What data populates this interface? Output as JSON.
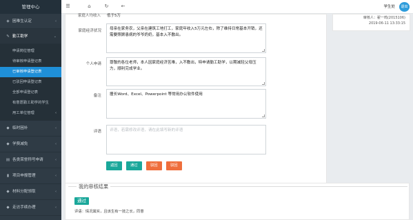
{
  "sidebar": {
    "title": "管理中心",
    "groups": [
      {
        "label": "困难生认定",
        "icon": "shield-icon",
        "chevron": "‹"
      },
      {
        "label": "勤工助学",
        "icon": "pen-icon",
        "chevron": "⌄"
      }
    ],
    "sub_items": [
      {
        "label": "申请岗位管理"
      },
      {
        "label": "待审核申请登记表"
      },
      {
        "label": "已审核申请登记表"
      },
      {
        "label": "已驳回申请登记表"
      },
      {
        "label": "全部申请登记表"
      },
      {
        "label": "有意愿勤工助学的学生"
      },
      {
        "label": "用工单位管理",
        "chevron": "‹"
      }
    ],
    "groups_after": [
      {
        "label": "临时困补",
        "icon": "tag-icon",
        "chevron": "‹"
      },
      {
        "label": "学费减免",
        "icon": "tag-icon",
        "chevron": "‹"
      },
      {
        "label": "各类荣誉称号申请",
        "icon": "book-icon",
        "chevron": "‹"
      },
      {
        "label": "项目申报管理",
        "icon": "bookmark-icon",
        "chevron": "‹"
      },
      {
        "label": "材料分配领取",
        "icon": "tag-icon",
        "chevron": "‹"
      },
      {
        "label": "走访手续办理",
        "icon": "tag-icon",
        "chevron": "‹"
      }
    ]
  },
  "topbar": {
    "menu_icon": "☰",
    "home_icon": "⌂",
    "refresh_icon": "↻",
    "back_icon": "←",
    "user": "学生处",
    "logout": "退出"
  },
  "form": {
    "top_cut_label": "家庭人均收入",
    "top_cut_value": "低于5万",
    "economy_label": "家庭经济状况",
    "economy_text": "母亲在家务农，父亲在建筑工地打工，家庭年收入5万元左右，除了维持日常基本开销，还需要照顾患病的爷爷奶奶，基本入不敷出。",
    "personal_label": "个人申请",
    "personal_text": "尊敬的各位老师，本人因家庭经济苦难，入不敷出，特申请勤工助学，以期减轻父母压力，顺利完成学业。",
    "remark_label": "备注",
    "remark_text": "擅长Word、Excel、Powerpoint 等常用办公软件使用",
    "comment_label": "评语",
    "comment_placeholder": "评语，若需修改评语，请在此填写新的评语",
    "buttons": {
      "back": "返回",
      "pass": "通过",
      "reject": "驳回",
      "deny": "驳回"
    }
  },
  "info": {
    "reviewer": "审核人：翟一鸣(2015106)",
    "date": "2019-06-11 13:33:15"
  },
  "result": {
    "title": "我的审核结果",
    "status": "通过",
    "comment": "评语：情况属实，且该生有一技之长，同意"
  },
  "colors": {
    "sidebar_bg": "#2f3b45",
    "active": "#1f8fd8",
    "teal": "#1aa79a",
    "orange": "#ef6e3c",
    "logout": "#2d9cdb"
  }
}
